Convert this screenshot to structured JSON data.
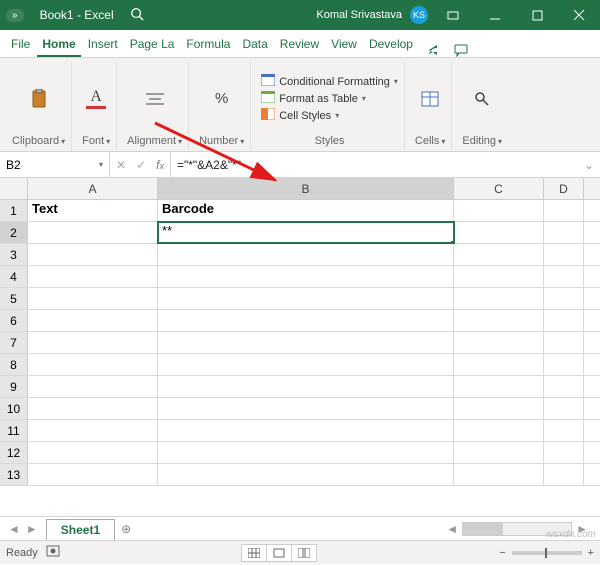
{
  "titlebar": {
    "autosave_label": "»",
    "book": "Book1",
    "app": "Excel",
    "user": "Komal Srivastava",
    "initials": "KS"
  },
  "tabs": {
    "file": "File",
    "home": "Home",
    "insert": "Insert",
    "pagelayout": "Page La",
    "formulas": "Formula",
    "data": "Data",
    "review": "Review",
    "view": "View",
    "developer": "Develop"
  },
  "ribbon": {
    "clipboard": "Clipboard",
    "font": "Font",
    "alignment": "Alignment",
    "number": "Number",
    "styles_label": "Styles",
    "cond_fmt": "Conditional Formatting",
    "fmt_table": "Format as Table",
    "cell_styles": "Cell Styles",
    "cells": "Cells",
    "editing": "Editing"
  },
  "formula_bar": {
    "namebox": "B2",
    "formula": "=\"*\"&A2&\"*\""
  },
  "columns": [
    "A",
    "B",
    "C",
    "D"
  ],
  "rows": [
    {
      "n": "1",
      "A": "Text",
      "B": "Barcode",
      "bold": true
    },
    {
      "n": "2",
      "A": "",
      "B": "**",
      "selected": "B"
    },
    {
      "n": "3"
    },
    {
      "n": "4"
    },
    {
      "n": "5"
    },
    {
      "n": "6"
    },
    {
      "n": "7"
    },
    {
      "n": "8"
    },
    {
      "n": "9"
    },
    {
      "n": "10"
    },
    {
      "n": "11"
    },
    {
      "n": "12"
    },
    {
      "n": "13"
    }
  ],
  "sheet": {
    "name": "Sheet1"
  },
  "status": {
    "ready": "Ready",
    "zoom_delta": "+"
  },
  "watermark": "wsxdn.com"
}
